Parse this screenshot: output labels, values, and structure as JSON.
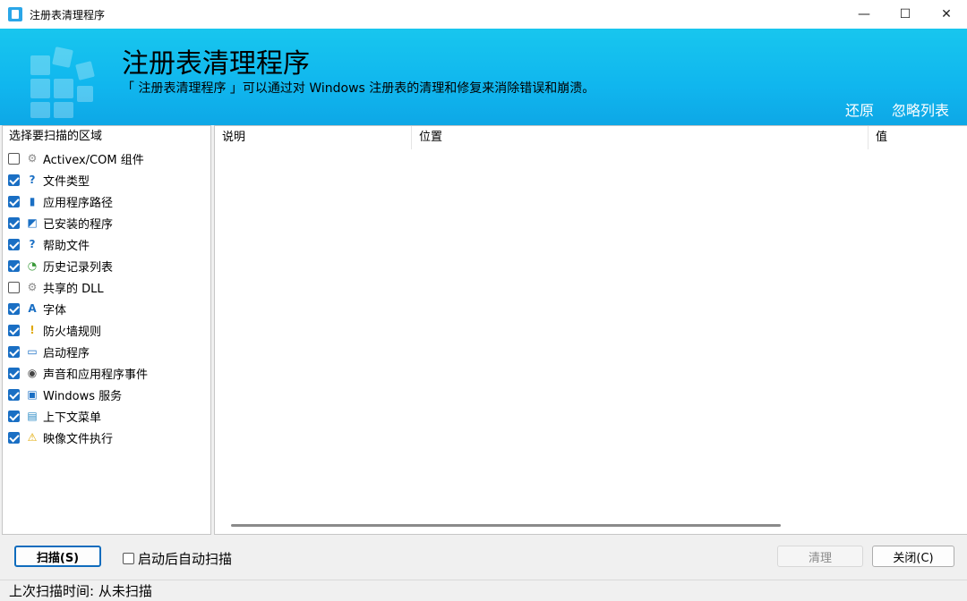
{
  "window": {
    "title": "注册表清理程序",
    "minimize_glyph": "—",
    "maximize_glyph": "☐",
    "close_glyph": "✕"
  },
  "banner": {
    "title": "注册表清理程序",
    "description": "「 注册表清理程序 」可以通过对 Windows 注册表的清理和修复来消除错误和崩溃。",
    "restore_label": "还原",
    "ignore_list_label": "忽略列表"
  },
  "left_panel": {
    "header": "选择要扫描的区域",
    "items": [
      {
        "label": "Activex/COM 组件",
        "checked": false,
        "icon": "component-icon",
        "glyph": "⚙",
        "color": "#8a8a8a"
      },
      {
        "label": "文件类型",
        "checked": true,
        "icon": "file-type-icon",
        "glyph": "?",
        "color": "#1a6fc4"
      },
      {
        "label": "应用程序路径",
        "checked": true,
        "icon": "app-path-icon",
        "glyph": "▮",
        "color": "#1a6fc4"
      },
      {
        "label": "已安装的程序",
        "checked": true,
        "icon": "installed-program-icon",
        "glyph": "◩",
        "color": "#1a6fc4"
      },
      {
        "label": "帮助文件",
        "checked": true,
        "icon": "help-icon",
        "glyph": "?",
        "color": "#1a6fc4"
      },
      {
        "label": "历史记录列表",
        "checked": true,
        "icon": "history-icon",
        "glyph": "◔",
        "color": "#3a9a3a"
      },
      {
        "label": "共享的 DLL",
        "checked": false,
        "icon": "dll-icon",
        "glyph": "⚙",
        "color": "#8a8a8a"
      },
      {
        "label": "字体",
        "checked": true,
        "icon": "font-icon",
        "glyph": "A",
        "color": "#1a6fc4"
      },
      {
        "label": "防火墙规则",
        "checked": true,
        "icon": "firewall-icon",
        "glyph": "!",
        "color": "#e0a800"
      },
      {
        "label": "启动程序",
        "checked": true,
        "icon": "startup-icon",
        "glyph": "▭",
        "color": "#1a6fc4"
      },
      {
        "label": "声音和应用程序事件",
        "checked": true,
        "icon": "sound-icon",
        "glyph": "◉",
        "color": "#444444"
      },
      {
        "label": "Windows 服务",
        "checked": true,
        "icon": "service-icon",
        "glyph": "▣",
        "color": "#1a6fc4"
      },
      {
        "label": "上下文菜单",
        "checked": true,
        "icon": "context-menu-icon",
        "glyph": "▤",
        "color": "#2a8ac4"
      },
      {
        "label": "映像文件执行",
        "checked": true,
        "icon": "warning-icon",
        "glyph": "⚠",
        "color": "#e0a800"
      }
    ]
  },
  "results_table": {
    "columns": [
      "说明",
      "位置",
      "值"
    ]
  },
  "bottom": {
    "scan_label": "扫描(S)",
    "auto_scan_label": "启动后自动扫描",
    "auto_scan_checked": false,
    "clean_label": "清理",
    "close_label": "关闭(C)"
  },
  "status": {
    "text": "上次扫描时间: 从未扫描"
  }
}
